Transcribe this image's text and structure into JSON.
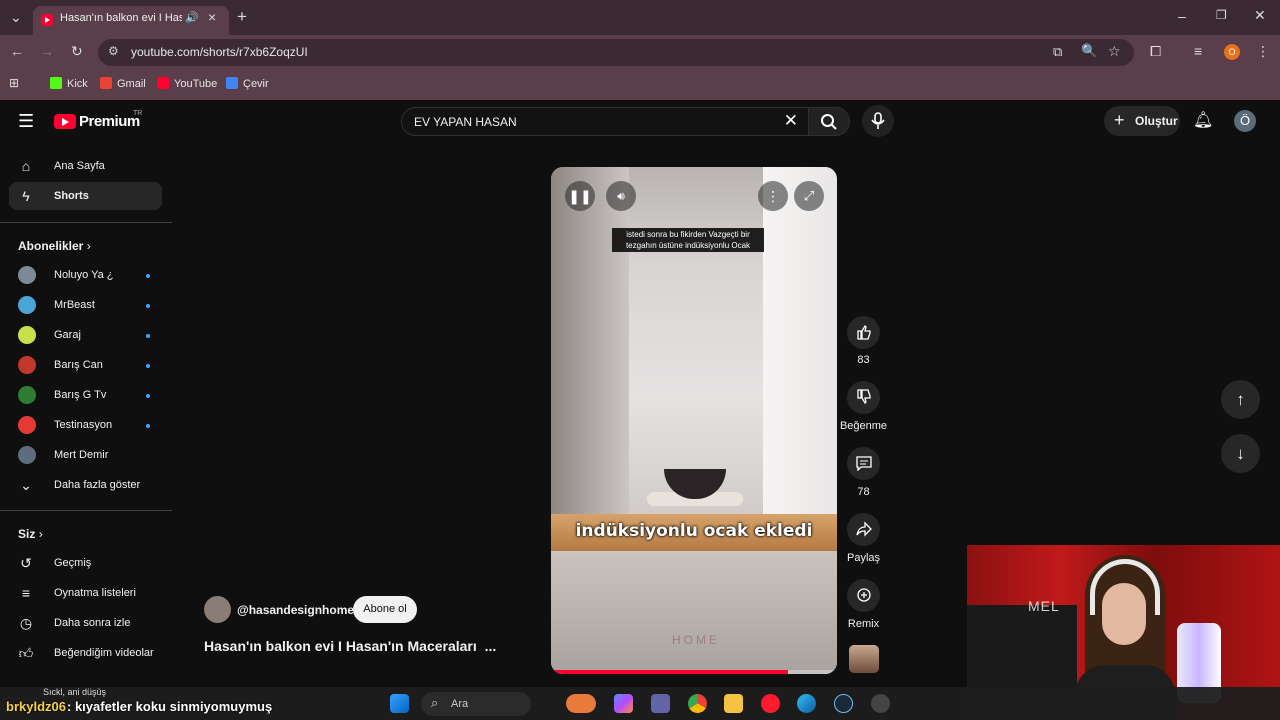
{
  "browser": {
    "tab_title": "Hasan'ın balkon evi I Hasan'ın Maceraları",
    "url": "youtube.com/shorts/r7xb6ZoqzUI",
    "bookmarks": [
      "Kick",
      "Gmail",
      "YouTube",
      "Çevir"
    ],
    "profile_initial": "O"
  },
  "youtube": {
    "logo_text": "Premium",
    "region": "TR",
    "search_value": "EV YAPAN HASAN",
    "create_label": "Oluştur",
    "avatar_initial": "Ö"
  },
  "sidebar": {
    "main_items": [
      {
        "label": "Ana Sayfa",
        "icon": "home-icon"
      },
      {
        "label": "Shorts",
        "icon": "shorts-icon",
        "active": true
      }
    ],
    "subscriptions_title": "Abonelikler",
    "subscriptions": [
      {
        "label": "Noluyo Ya ¿",
        "color": "#7c8a96"
      },
      {
        "label": "MrBeast",
        "color": "#4aa6d6"
      },
      {
        "label": "Garaj",
        "color": "#c8e04a"
      },
      {
        "label": "Barış Can",
        "color": "#c0392b"
      },
      {
        "label": "Barış G Tv",
        "color": "#2e7d32"
      },
      {
        "label": "Testinasyon",
        "color": "#e53935"
      },
      {
        "label": "Mert Demir",
        "color": "#5d6d7e"
      }
    ],
    "show_more": "Daha fazla göster",
    "you_title": "Siz",
    "you_items": [
      {
        "label": "Geçmiş",
        "icon": "history-icon"
      },
      {
        "label": "Oynatma listeleri",
        "icon": "playlists-icon"
      },
      {
        "label": "Daha sonra izle",
        "icon": "watch-later-icon"
      },
      {
        "label": "Beğendiğim videolar",
        "icon": "liked-videos-icon"
      }
    ]
  },
  "short": {
    "caption_top": "istedi sonra bu fikirden Vazgeçti bir tezgahın üstüne indüksiyonlu Ocak",
    "caption_main": "indüksiyonlu ocak ekledi",
    "watermark": "HOME",
    "progress": 0.83,
    "channel": "@hasandesignhome",
    "subscribe_label": "Abone ol",
    "title": "Hasan'ın balkon evi I Hasan'ın Maceraları",
    "title_more": "..."
  },
  "actions": {
    "like_count": "83",
    "dislike_label": "Beğenme",
    "comment_count": "78",
    "share_label": "Paylaş",
    "remix_label": "Remix"
  },
  "overlay": {
    "chat_user": "brkyldz06",
    "chat_message": ": kıyafetler koku sinmiyomuymuş",
    "chat_ticker": "Sıckl, ani düşüş",
    "cam_text": "MEL"
  },
  "taskbar": {
    "search_label": "Ara"
  }
}
